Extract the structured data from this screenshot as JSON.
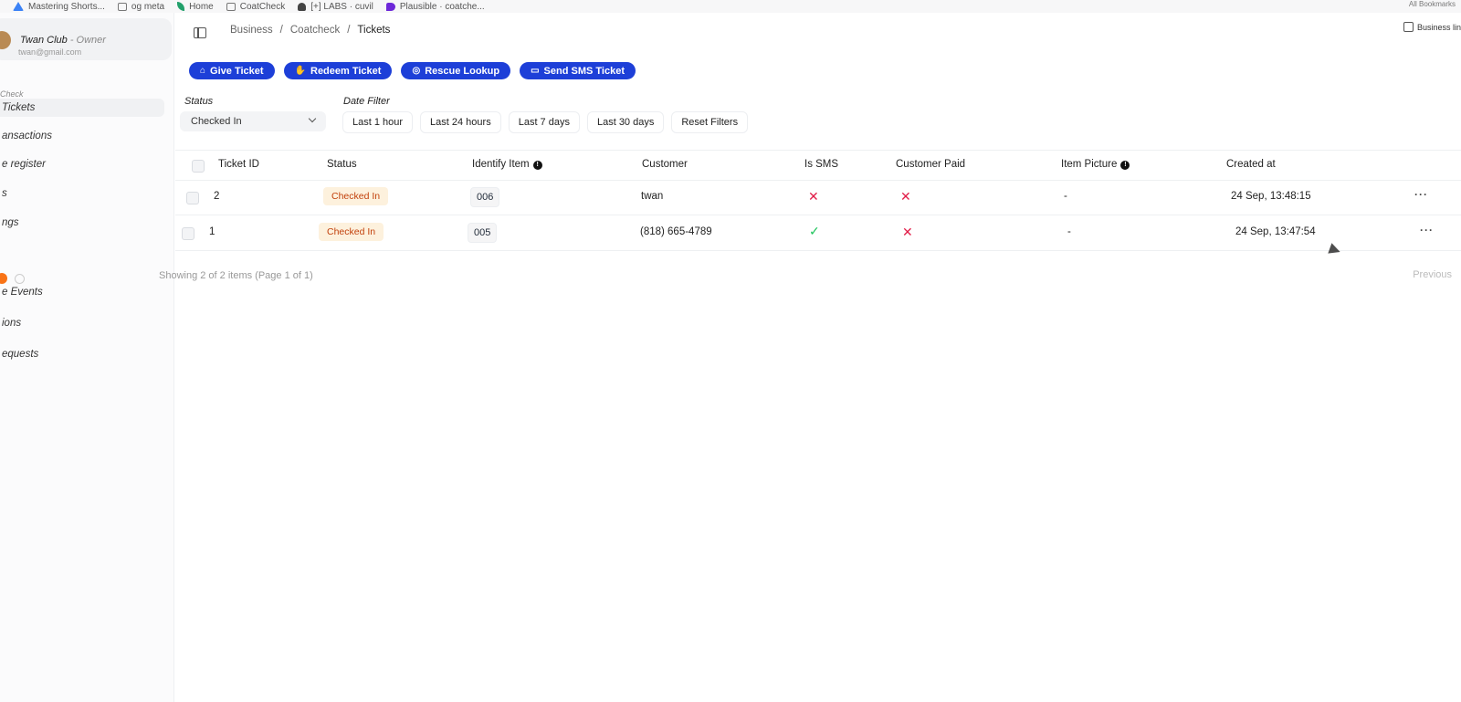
{
  "bookmarks": [
    {
      "label": "Mastering Shorts...",
      "icon": "drive-icon"
    },
    {
      "label": "og meta",
      "icon": "page-icon"
    },
    {
      "label": "Home",
      "icon": "leaf-icon"
    },
    {
      "label": "CoatCheck",
      "icon": "folder-icon"
    },
    {
      "label": "[+] LABS · cuvil",
      "icon": "user-icon"
    },
    {
      "label": "Plausible · coatche...",
      "icon": "plausible-icon"
    }
  ],
  "bookmarks_right": "All Bookmarks",
  "profile": {
    "name": "Twan Club",
    "role": " - Owner",
    "email": "twan@gmail.com"
  },
  "sidebar": {
    "section": "Check",
    "items": [
      {
        "label": "Tickets",
        "active": true
      },
      {
        "label": "ansactions"
      },
      {
        "label": "e register"
      },
      {
        "label": "s"
      },
      {
        "label": "ngs"
      },
      {
        "label": "e Events"
      },
      {
        "label": "ions"
      },
      {
        "label": "equests"
      }
    ]
  },
  "breadcrumb": {
    "items": [
      "Business",
      "Coatcheck",
      "Tickets"
    ],
    "sep": "/"
  },
  "header_right": "Business lin",
  "actions": [
    {
      "label": "Give Ticket",
      "icon": "hanger-icon"
    },
    {
      "label": "Redeem Ticket",
      "icon": "hand-icon"
    },
    {
      "label": "Rescue Lookup",
      "icon": "lifebuoy-icon"
    },
    {
      "label": "Send SMS Ticket",
      "icon": "message-icon"
    }
  ],
  "filters": {
    "status_label": "Status",
    "status_value": "Checked In",
    "date_label": "Date Filter",
    "date_options": [
      "Last 1 hour",
      "Last 24 hours",
      "Last 7 days",
      "Last 30 days",
      "Reset Filters"
    ]
  },
  "table": {
    "columns": [
      "Ticket ID",
      "Status",
      "Identify Item",
      "Customer",
      "Is SMS",
      "Customer Paid",
      "Item Picture",
      "Created at"
    ],
    "rows": [
      {
        "id": "2",
        "status": "Checked In",
        "item": "006",
        "customer": "twan",
        "is_sms": false,
        "paid": false,
        "picture": "-",
        "created": "24 Sep, 13:48:15"
      },
      {
        "id": "1",
        "status": "Checked In",
        "item": "005",
        "customer": "(818) 665-4789",
        "is_sms": true,
        "paid": false,
        "picture": "-",
        "created": "24 Sep, 13:47:54"
      }
    ]
  },
  "pagination": {
    "summary": "Showing 2 of 2 items (Page 1 of 1)",
    "previous": "Previous"
  },
  "colors": {
    "primary": "#1d3fd8",
    "badge_bg": "#fdf1dd",
    "badge_text": "#c2410c",
    "danger": "#e11d48",
    "success": "#22c55e"
  }
}
